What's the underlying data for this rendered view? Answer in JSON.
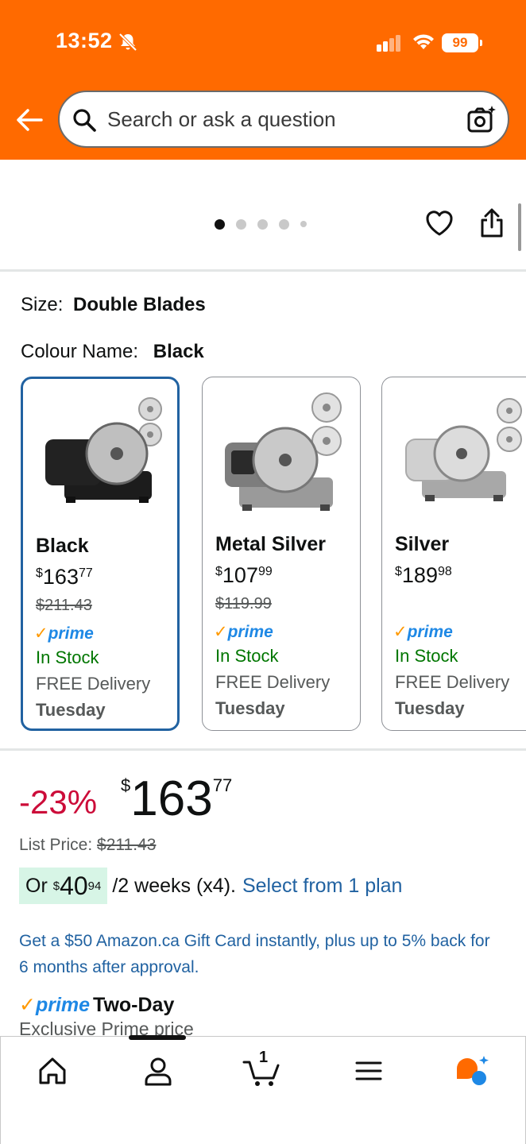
{
  "status_bar": {
    "time": "13:52",
    "battery": "99",
    "icons": [
      "bell-muted-icon",
      "signal-icon",
      "wifi-icon",
      "battery-icon"
    ]
  },
  "header": {
    "back_icon": "back-arrow-icon",
    "search_placeholder": "Search or ask a question",
    "search_icon": "search-icon",
    "camera_icon": "camera-search-icon"
  },
  "gallery": {
    "dot_count": 5,
    "active_index": 0,
    "actions": [
      "heart-icon",
      "share-icon"
    ]
  },
  "size": {
    "label": "Size:",
    "value": "Double Blades"
  },
  "colour": {
    "label": "Colour Name:",
    "value": "Black"
  },
  "variants": [
    {
      "name": "Black",
      "price_currency": "$",
      "price_whole": "163",
      "price_fraction": "77",
      "list_price": "$211.43",
      "prime": "prime",
      "stock": "In Stock",
      "delivery": "FREE Delivery",
      "day": "Tuesday",
      "selected": true
    },
    {
      "name": "Metal Silver",
      "price_currency": "$",
      "price_whole": "107",
      "price_fraction": "99",
      "list_price": "$119.99",
      "prime": "prime",
      "stock": "In Stock",
      "delivery": "FREE Delivery",
      "day": "Tuesday",
      "selected": false
    },
    {
      "name": "Silver",
      "price_currency": "$",
      "price_whole": "189",
      "price_fraction": "98",
      "list_price": "",
      "prime": "prime",
      "stock": "In Stock",
      "delivery": "FREE Delivery",
      "day": "Tuesday",
      "selected": false
    }
  ],
  "pricing": {
    "discount": "-23%",
    "currency": "$",
    "whole": "163",
    "fraction": "77",
    "list_price_label": "List Price:",
    "list_price": "$211.43",
    "installment_prefix": "Or",
    "installment_currency": "$",
    "installment_whole": "40",
    "installment_fraction": "94",
    "installment_terms": "/2 weeks (x4).",
    "installment_link": "Select from 1 plan",
    "gift_card_offer": "Get a $50 Amazon.ca Gift Card instantly, plus up to 5% back for 6 months after approval.",
    "prime_label": "prime",
    "prime_shipping": "Two-Day",
    "exclusive": "Exclusive Prime price"
  },
  "colors": {
    "brand_orange": "#ff6a00",
    "link_blue": "#2162a1",
    "prime_blue": "#1e88e5",
    "deal_red": "#cc0c39",
    "stock_green": "#007600"
  },
  "bottom_nav": {
    "items": [
      "home-icon",
      "account-icon",
      "cart-icon",
      "menu-icon",
      "rufus-assistant-icon"
    ],
    "cart_count": "1",
    "active_index": 1
  }
}
